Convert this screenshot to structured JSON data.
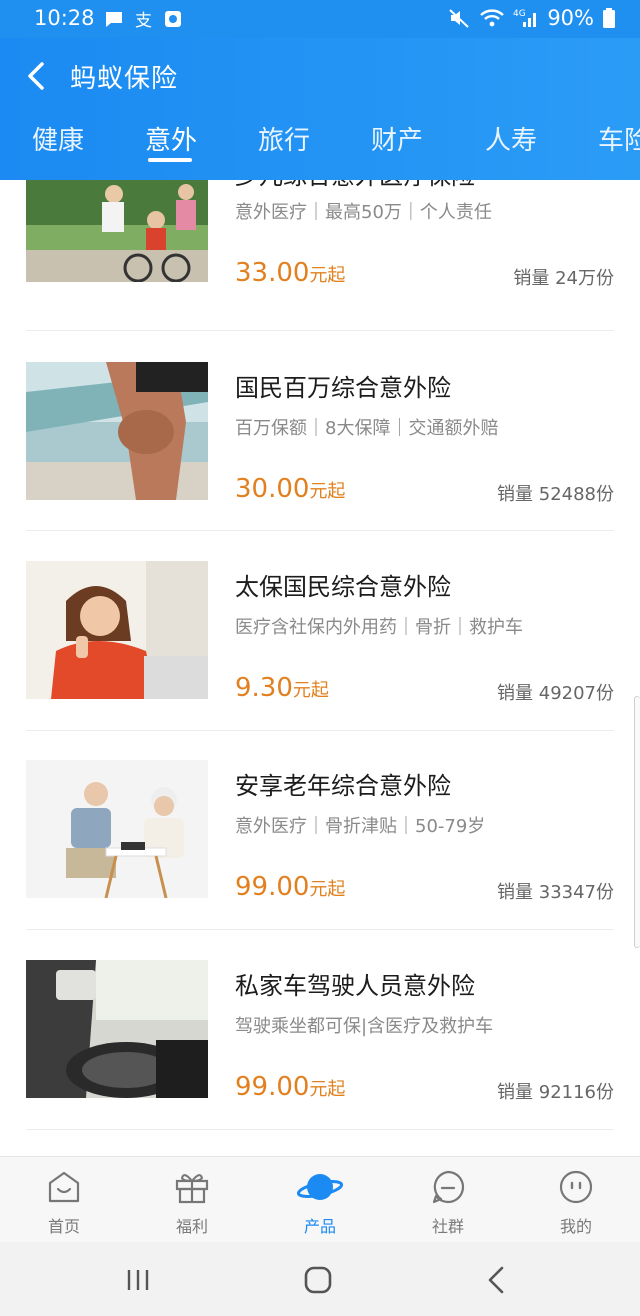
{
  "status_bar": {
    "time": "10:28",
    "battery": "90%",
    "network": "4G"
  },
  "header": {
    "title": "蚂蚁保险",
    "tabs": [
      {
        "label": "健康",
        "active": false
      },
      {
        "label": "意外",
        "active": true
      },
      {
        "label": "旅行",
        "active": false
      },
      {
        "label": "财产",
        "active": false
      },
      {
        "label": "人寿",
        "active": false
      },
      {
        "label": "车险",
        "active": false
      }
    ]
  },
  "products": [
    {
      "title": "少儿综合意外医疗保险",
      "tags": "意外医疗｜最高50万｜个人责任",
      "price": "33.00",
      "price_unit": "元起",
      "sales": "销量 24万份",
      "image": "family-cycling"
    },
    {
      "title": "国民百万综合意外险",
      "tags": "百万保额｜8大保障｜交通额外赔",
      "price": "30.00",
      "price_unit": "元起",
      "sales": "销量 52488份",
      "image": "knee-injury"
    },
    {
      "title": "太保国民综合意外险",
      "tags": "医疗含社保内外用药｜骨折｜救护车",
      "price": "9.30",
      "price_unit": "元起",
      "sales": "销量 49207份",
      "image": "woman-thumbs-up"
    },
    {
      "title": "安享老年综合意外险",
      "tags": "意外医疗｜骨折津贴｜50-79岁",
      "price": "99.00",
      "price_unit": "元起",
      "sales": "销量 33347份",
      "image": "elderly-chess"
    },
    {
      "title": "私家车驾驶人员意外险",
      "tags": "驾驶乘坐都可保|含医疗及救护车",
      "price": "99.00",
      "price_unit": "元起",
      "sales": "销量 92116份",
      "image": "car-driver"
    }
  ],
  "bottom_nav": [
    {
      "label": "首页",
      "icon": "home-icon",
      "active": false
    },
    {
      "label": "福利",
      "icon": "gift-icon",
      "active": false
    },
    {
      "label": "产品",
      "icon": "planet-icon",
      "active": true
    },
    {
      "label": "社群",
      "icon": "chat-icon",
      "active": false
    },
    {
      "label": "我的",
      "icon": "smile-icon",
      "active": false
    }
  ],
  "colors": {
    "header_blue": "#1b8af2",
    "price_orange": "#e2801f",
    "active_nav": "#1b8af2"
  }
}
